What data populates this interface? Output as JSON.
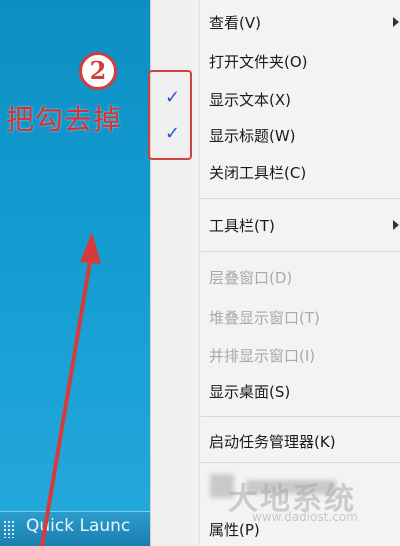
{
  "annotation": {
    "step_number": "2",
    "instruction": "把勾去掉"
  },
  "desktop": {
    "quick_launch_label": "Quick Launc"
  },
  "menu": {
    "items": [
      {
        "label": "查看(V)",
        "submenu": true,
        "checked": false,
        "disabled": false
      },
      {
        "label": "打开文件夹(O)",
        "submenu": false,
        "checked": false,
        "disabled": false
      },
      {
        "label": "显示文本(X)",
        "submenu": false,
        "checked": true,
        "disabled": false
      },
      {
        "label": "显示标题(W)",
        "submenu": false,
        "checked": true,
        "disabled": false
      },
      {
        "label": "关闭工具栏(C)",
        "submenu": false,
        "checked": false,
        "disabled": false
      },
      {
        "label": "工具栏(T)",
        "submenu": true,
        "checked": false,
        "disabled": false
      },
      {
        "label": "层叠窗口(D)",
        "submenu": false,
        "checked": false,
        "disabled": true
      },
      {
        "label": "堆叠显示窗口(T)",
        "submenu": false,
        "checked": false,
        "disabled": true
      },
      {
        "label": "并排显示窗口(I)",
        "submenu": false,
        "checked": false,
        "disabled": true
      },
      {
        "label": "显示桌面(S)",
        "submenu": false,
        "checked": false,
        "disabled": false
      },
      {
        "label": "启动任务管理器(K)",
        "submenu": false,
        "checked": false,
        "disabled": false
      },
      {
        "label": "属性(P)",
        "submenu": false,
        "checked": false,
        "disabled": false
      }
    ],
    "check_glyph": "✓"
  },
  "watermark": {
    "text": "大地系统",
    "sub": "www.dadiost.com"
  },
  "colors": {
    "desktop_blue": "#129bd0",
    "annotation_red": "#d63b3b",
    "check_blue": "#2a56c6"
  }
}
